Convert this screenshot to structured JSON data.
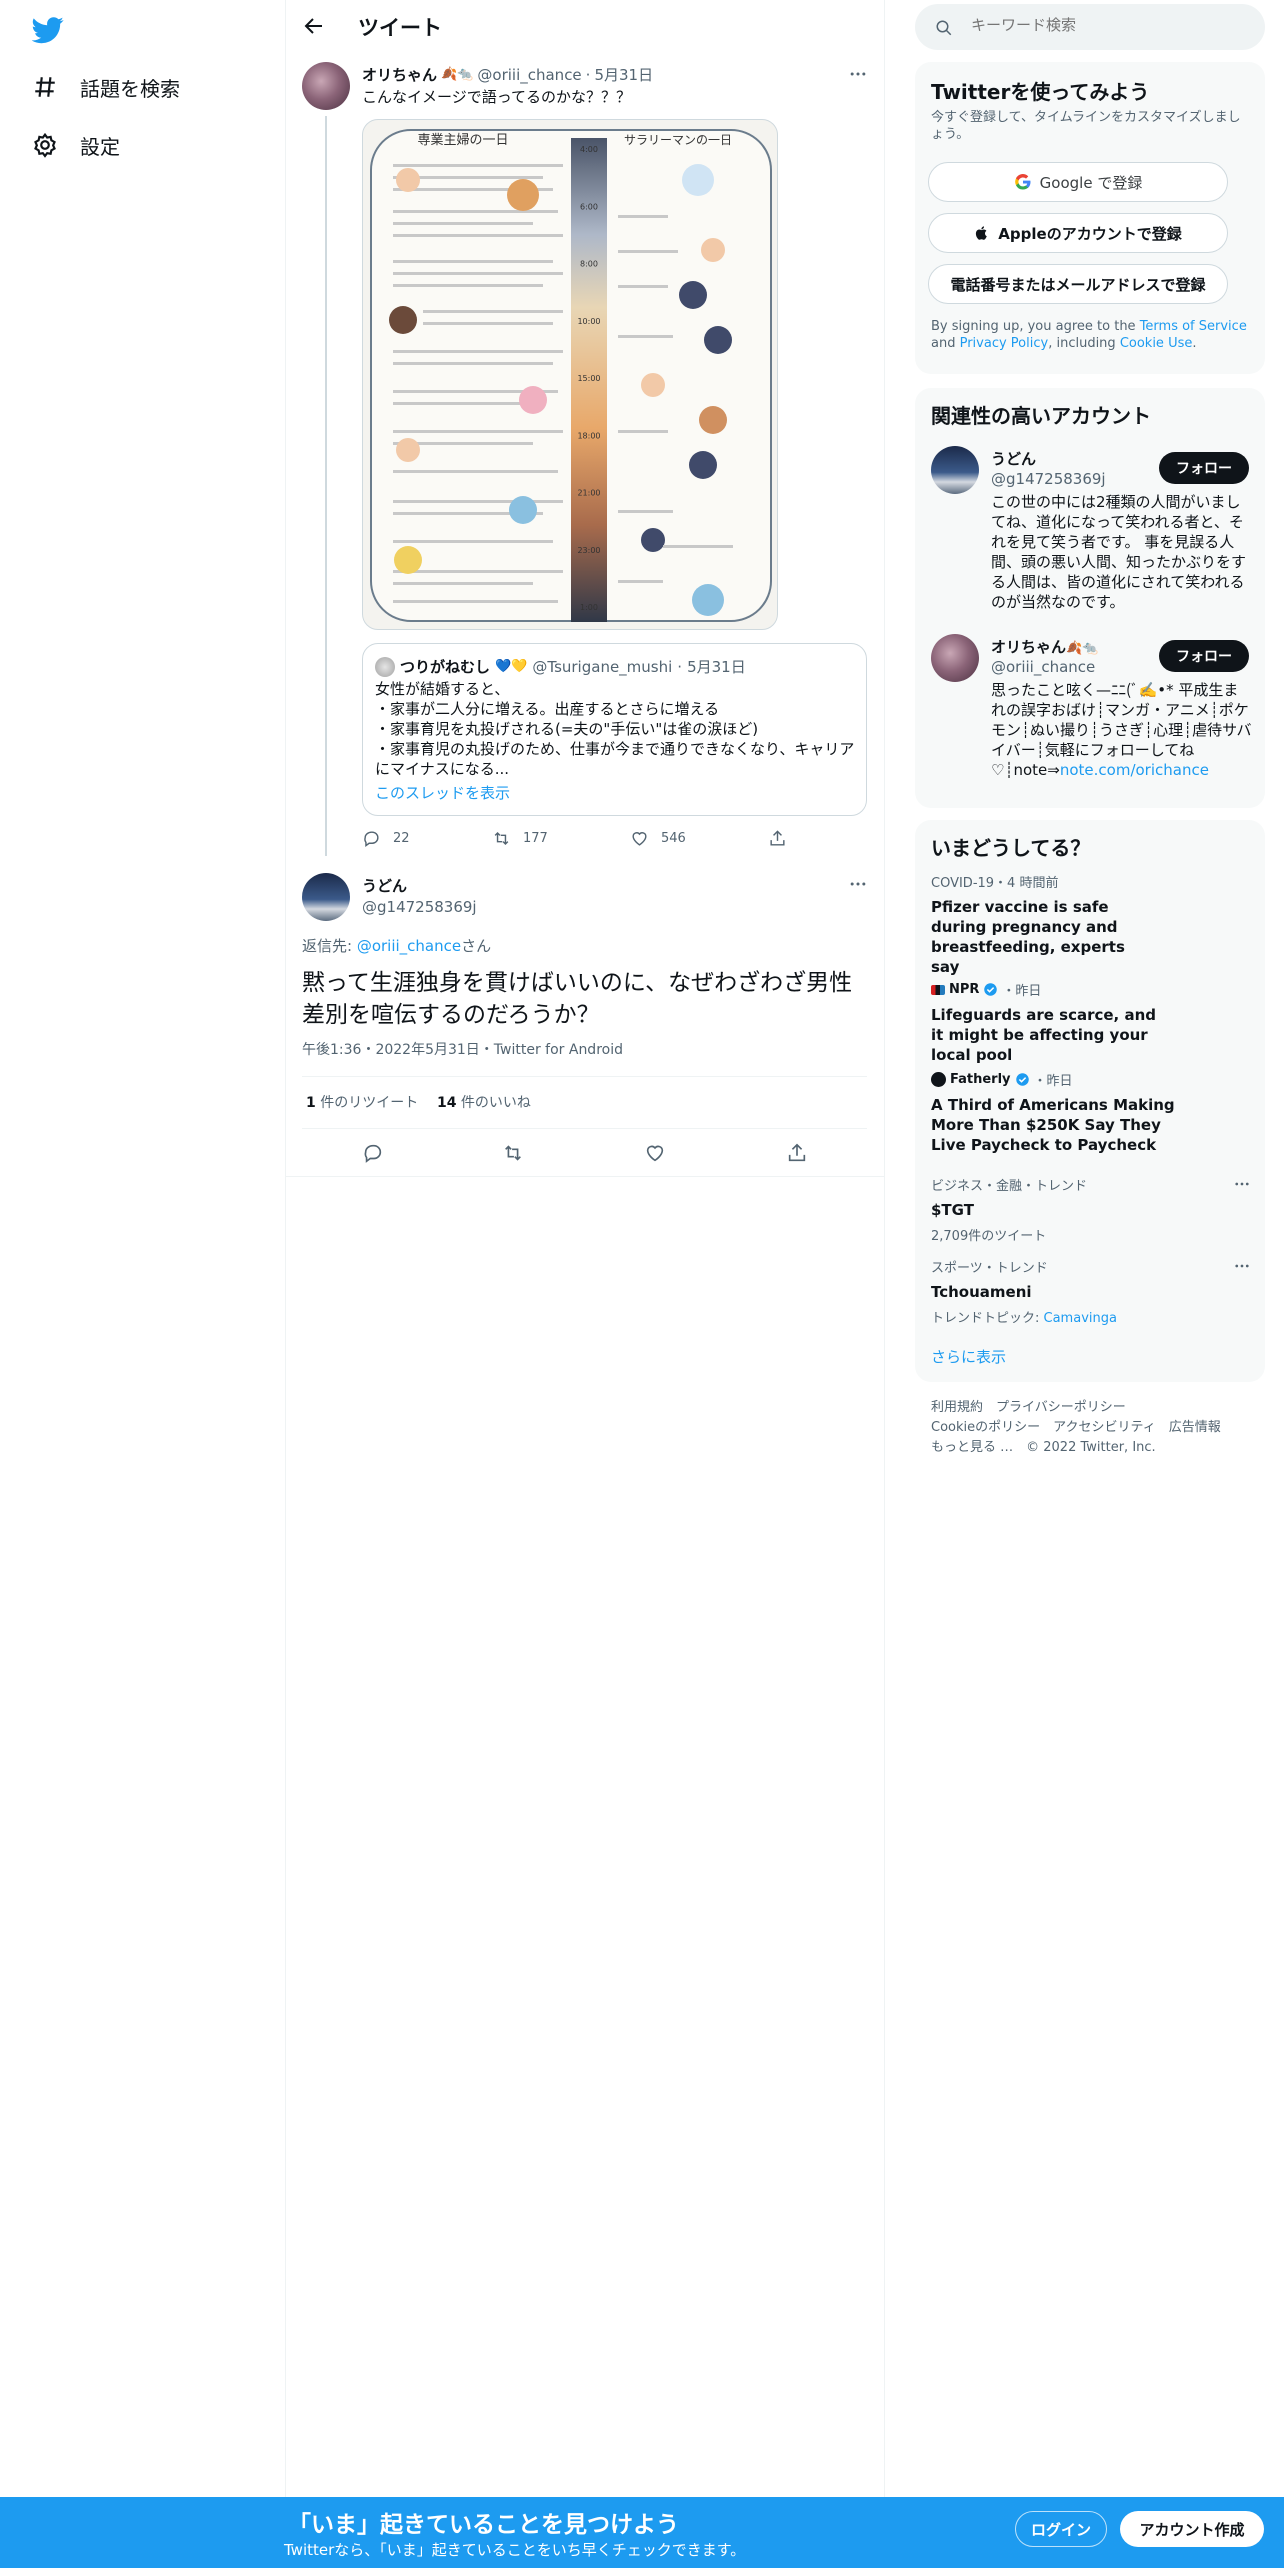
{
  "nav": {
    "explore_label": "話題を検索",
    "settings_label": "設定"
  },
  "header": {
    "title": "ツイート"
  },
  "quoted_tweet": {
    "author_name": "オリちゃん",
    "author_emoji": "🍂🐀",
    "handle": "@oriii_chance",
    "date": "5月31日",
    "text": "こんなイメージで語ってるのかな？？？",
    "image": {
      "left_title": "専業主婦の一日",
      "right_title": "サラリーマンの一日",
      "times": [
        "4:00",
        "6:00",
        "8:00",
        "10:00",
        "15:00",
        "18:00",
        "21:00",
        "23:00",
        "1:00"
      ]
    },
    "inner_quote": {
      "author_name": "つりがねむし",
      "author_emoji": "💙💛",
      "handle": "@Tsurigane_mushi",
      "date": "5月31日",
      "lines": [
        "女性が結婚すると、",
        "・家事が二人分に増える。出産するとさらに増える",
        "・家事育児を丸投げされる(=夫の\"手伝い\"は雀の涙ほど)",
        "・家事育児の丸投げのため、仕事が今まで通りできなくなり、キャリアにマイナスになる..."
      ],
      "thread_link": "このスレッドを表示"
    },
    "stats": {
      "replies": "22",
      "retweets": "177",
      "likes": "546"
    }
  },
  "main_tweet": {
    "author_name": "うどん",
    "handle": "@g147258369j",
    "reply_to_prefix": "返信先: ",
    "reply_to_handle": "@oriii_chance",
    "reply_to_suffix": "さん",
    "text": "黙って生涯独身を貫けばいいのに、なぜわざわざ男性差別を喧伝するのだろうか？",
    "timestamp": "午後1:36・2022年5月31日・Twitter for Android",
    "retweet_count": "1",
    "retweet_label": " 件のリツイート",
    "like_count": "14",
    "like_label": " 件のいいね"
  },
  "search": {
    "placeholder": "キーワード検索"
  },
  "signup_card": {
    "title": "Twitterを使ってみよう",
    "subtitle": "今すぐ登録して、タイムラインをカスタマイズしましょう。",
    "google_label": "Google で登録",
    "apple_label": "Appleのアカウントで登録",
    "phone_label": "電話番号またはメールアドレスで登録",
    "terms_prefix": "By signing up, you agree to the ",
    "terms_link": "Terms of Service",
    "terms_and": " and ",
    "privacy_link": "Privacy Policy",
    "terms_including": ", including ",
    "cookie_link": "Cookie Use",
    "terms_end": "."
  },
  "relevant_accounts": {
    "title": "関連性の高いアカウント",
    "accounts": [
      {
        "name": "うどん",
        "handle": "@g147258369j",
        "follow_label": "フォロー",
        "bio": "この世の中には2種類の人間がいましてね、道化になって笑われる者と、それを見て笑う者です。 事を見誤る人間、頭の悪い人間、知ったかぶりをする人間は、皆の道化にされて笑われるのが当然なのです。"
      },
      {
        "name": "オリちゃん",
        "name_emoji": "🍂🐀",
        "handle": "@oriii_chance",
        "follow_label": "フォロー",
        "bio": "思ったこと呟く—ﾆﾆ(ﾞ✍️•* 平成生まれの誤字おばけ┊マンガ・アニメ┊ポケモン┊ぬい撮り┊うさぎ┊心理┊虐待サバイバー┊気軽にフォローしてね♡┊note⇒",
        "bio_link": "note.com/orichance"
      }
    ]
  },
  "trends": {
    "title": "いまどうしてる？",
    "items": [
      {
        "meta": "COVID-19・4 時間前",
        "title": "Pfizer vaccine is safe during pregnancy and breastfeeding, experts say"
      },
      {
        "source": "NPR",
        "meta": "・昨日",
        "title": "Lifeguards are scarce, and it might be affecting your local pool"
      },
      {
        "source": "Fatherly",
        "meta": "・昨日",
        "title": "A Third of Americans Making More Than $250K Say They Live Paycheck to Paycheck"
      },
      {
        "meta": "ビジネス・金融・トレンド",
        "title": "$TGT",
        "sub": "2,709件のツイート"
      },
      {
        "meta": "スポーツ・トレンド",
        "title": "Tchouameni",
        "sub_prefix": "トレンドトピック: ",
        "sub_link": "Camavinga"
      }
    ],
    "show_more": "さらに表示"
  },
  "footer": {
    "line1": "利用規約　プライバシーポリシー",
    "line2": "Cookieのポリシー　アクセシビリティ　広告情報",
    "line3": "もっと見る …　© 2022 Twitter, Inc."
  },
  "bottom_bar": {
    "title": "「いま」起きていることを見つけよう",
    "subtitle": "Twitterなら、「いま」起きていることをいち早くチェックできます。",
    "login_label": "ログイン",
    "signup_label": "アカウント作成"
  },
  "colors": {
    "accent": "#1d9bf0",
    "text": "#0f1419",
    "secondary": "#536471"
  }
}
